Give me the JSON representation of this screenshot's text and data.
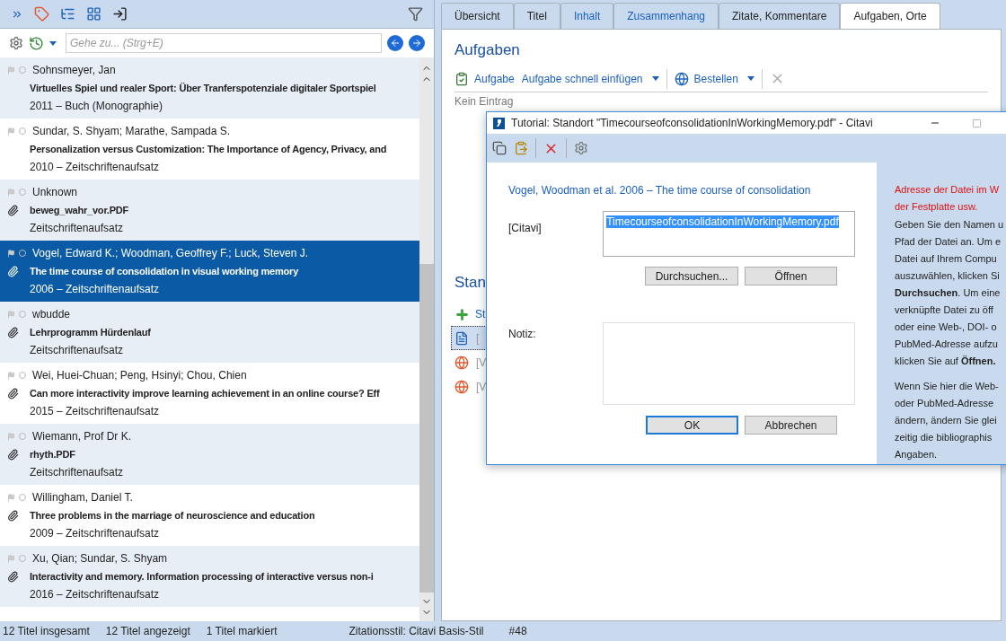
{
  "search": {
    "placeholder": "Gehe zu... (Strg+E)"
  },
  "references": [
    {
      "authors": "Sohnsmeyer, Jan",
      "title": "Virtuelles Spiel und realer Sport: Über Tranferspotenziale digitaler Sportspiel",
      "meta": "2011 – Buch (Monographie)",
      "attachment": false,
      "selected": false
    },
    {
      "authors": "Sundar, S. Shyam; Marathe, Sampada S.",
      "title": "Personalization versus Customization: The Importance of Agency, Privacy, and",
      "meta": "2010 – Zeitschriftenaufsatz",
      "attachment": false,
      "selected": false
    },
    {
      "authors": "Unknown",
      "title": "beweg_wahr_vor.PDF",
      "meta": "Zeitschriftenaufsatz",
      "attachment": true,
      "selected": false
    },
    {
      "authors": "Vogel, Edward K.; Woodman, Geoffrey F.; Luck, Steven J.",
      "title": "The time course of consolidation in visual working memory",
      "meta": "2006 – Zeitschriftenaufsatz",
      "attachment": true,
      "selected": true
    },
    {
      "authors": "wbudde",
      "title": "Lehrprogramm Hürdenlauf",
      "meta": "Zeitschriftenaufsatz",
      "attachment": true,
      "selected": false
    },
    {
      "authors": "Wei, Huei-Chuan; Peng, Hsinyi; Chou, Chien",
      "title": "Can more interactivity improve learning achievement in an online course? Eff",
      "meta": "2015 – Zeitschriftenaufsatz",
      "attachment": true,
      "selected": false
    },
    {
      "authors": "Wiemann, Prof Dr K.",
      "title": "rhyth.PDF",
      "meta": "Zeitschriftenaufsatz",
      "attachment": true,
      "selected": false
    },
    {
      "authors": "Willingham, Daniel T.",
      "title": "Three problems in the marriage of neuroscience and education",
      "meta": "2009 – Zeitschriftenaufsatz",
      "attachment": true,
      "selected": false
    },
    {
      "authors": "Xu, Qian; Sundar, S. Shyam",
      "title": "Interactivity and memory. Information processing of interactive versus non-i",
      "meta": "2016 – Zeitschriftenaufsatz",
      "attachment": true,
      "selected": false
    }
  ],
  "status_bar": [
    "12 Titel insgesamt",
    "12 Titel angezeigt",
    "1 Titel markiert",
    "Zitationsstil: Citavi Basis-Stil",
    "#48"
  ],
  "tabs": [
    {
      "label": "Übersicht",
      "selected": false,
      "has_content": false
    },
    {
      "label": "Titel",
      "selected": false,
      "has_content": false
    },
    {
      "label": "Inhalt",
      "selected": false,
      "has_content": true
    },
    {
      "label": "Zusammenhang",
      "selected": false,
      "has_content": true
    },
    {
      "label": "Zitate, Kommentare",
      "selected": false,
      "has_content": false
    },
    {
      "label": "Aufgaben, Orte",
      "selected": true,
      "has_content": false
    }
  ],
  "tasks": {
    "heading": "Aufgaben",
    "toolbar": [
      {
        "kind": "add",
        "label": "Aufgabe"
      },
      {
        "kind": "menu",
        "label": "Aufgabe schnell einfügen"
      },
      {
        "kind": "order",
        "label": "Bestellen"
      }
    ],
    "empty_text": "Kein Eintrag"
  },
  "locations": {
    "heading": "Stan",
    "add_label": "St",
    "items": [
      {
        "kind": "pdf",
        "label": "[",
        "selected": true
      },
      {
        "kind": "web",
        "label": "[V",
        "selected": false
      },
      {
        "kind": "web",
        "label": "[V",
        "selected": false
      }
    ]
  },
  "dialog": {
    "title": "Tutorial: Standort \"TimecourseofconsolidationInWorkingMemory.pdf\" - Citavi",
    "reference": "Vogel, Woodman et al. 2006 – The time course of consolidation",
    "location_label": "[Citavi]",
    "location_value": "TimecourseofconsolidationInWorkingMemory.pdf",
    "browse_button": "Durchsuchen...",
    "open_button": "Öffnen",
    "note_label": "Notiz:",
    "ok_button": "OK",
    "cancel_button": "Abbrechen",
    "help_heading": [
      "Adresse der Datei im W",
      "der Festplatte usw."
    ],
    "help_paragraphs": [
      [
        "Geben Sie den Namen u",
        "Pfad der Datei an. Um e",
        "Datei auf Ihrem Compu",
        "auszuwählen, klicken Si",
        "**Durchsuchen**. Um eine",
        "verknüpfte Datei zu öff",
        "oder eine Web-, DOI- o",
        "PubMed-Adresse aufzu",
        "klicken Sie auf **Öffnen.**"
      ],
      [
        "Wenn Sie hier die Web-",
        "oder PubMed-Adresse",
        "ändern, ändern Sie glei",
        "zeitig die bibliographis",
        "Angaben."
      ]
    ]
  }
}
